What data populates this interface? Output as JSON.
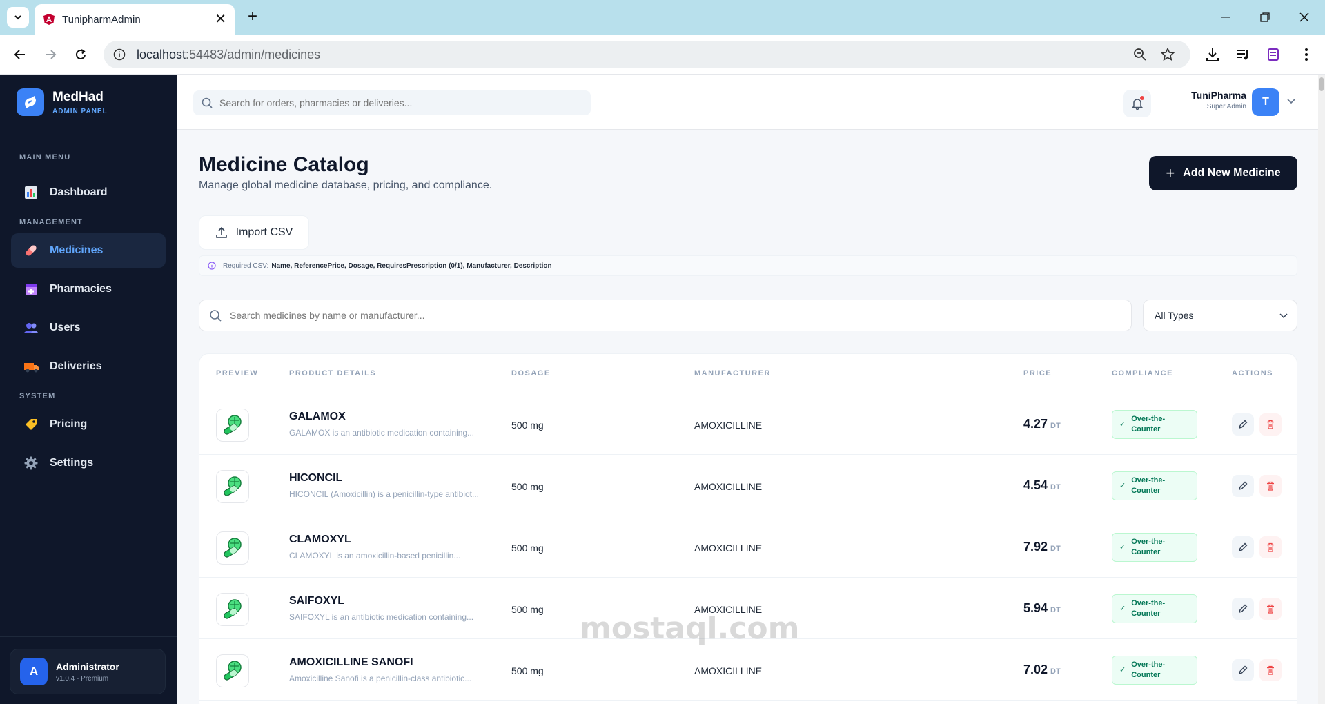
{
  "browser": {
    "tab_title": "TunipharmAdmin",
    "url_host": "localhost",
    "url_rest": ":54483/admin/medicines"
  },
  "brand": {
    "name": "MedHad",
    "subtitle": "ADMIN PANEL"
  },
  "sidebar": {
    "sections": {
      "main": "MAIN MENU",
      "management": "MANAGEMENT",
      "system": "SYSTEM"
    },
    "items": [
      {
        "label": "Dashboard",
        "icon": "chart-icon"
      },
      {
        "label": "Medicines",
        "icon": "pill-icon",
        "active": true
      },
      {
        "label": "Pharmacies",
        "icon": "pharmacy-icon"
      },
      {
        "label": "Users",
        "icon": "users-icon"
      },
      {
        "label": "Deliveries",
        "icon": "truck-icon"
      },
      {
        "label": "Pricing",
        "icon": "tag-icon"
      },
      {
        "label": "Settings",
        "icon": "gear-icon"
      }
    ],
    "user": {
      "initial": "A",
      "name": "Administrator",
      "version": "v1.0.4 - Premium"
    }
  },
  "topbar": {
    "search_placeholder": "Search for orders, pharmacies or deliveries...",
    "user_name": "TuniPharma",
    "user_role": "Super Admin",
    "user_initial": "T"
  },
  "page": {
    "title": "Medicine Catalog",
    "subtitle": "Manage global medicine database, pricing, and compliance.",
    "add_button": "Add New Medicine",
    "import_button": "Import CSV",
    "csv_label": "Required CSV:",
    "csv_fields": "Name, ReferencePrice, Dosage, RequiresPrescription (0/1), Manufacturer, Description",
    "search_placeholder": "Search medicines by name or manufacturer...",
    "type_filter": "All Types"
  },
  "table": {
    "headers": [
      "PREVIEW",
      "PRODUCT DETAILS",
      "DOSAGE",
      "MANUFACTURER",
      "PRICE",
      "COMPLIANCE",
      "ACTIONS"
    ],
    "currency": "DT",
    "rows": [
      {
        "name": "GALAMOX",
        "desc": "GALAMOX is an antibiotic medication containing...",
        "dosage": "500 mg",
        "manufacturer": "AMOXICILLINE",
        "price": "4.27",
        "compliance_1": "Over-the-",
        "compliance_2": "Counter"
      },
      {
        "name": "HICONCIL",
        "desc": "HICONCIL (Amoxicillin) is a penicillin-type antibiot...",
        "dosage": "500 mg",
        "manufacturer": "AMOXICILLINE",
        "price": "4.54",
        "compliance_1": "Over-the-",
        "compliance_2": "Counter"
      },
      {
        "name": "CLAMOXYL",
        "desc": "CLAMOXYL is an amoxicillin-based penicillin...",
        "dosage": "500 mg",
        "manufacturer": "AMOXICILLINE",
        "price": "7.92",
        "compliance_1": "Over-the-",
        "compliance_2": "Counter"
      },
      {
        "name": "SAIFOXYL",
        "desc": "SAIFOXYL is an antibiotic medication containing...",
        "dosage": "500 mg",
        "manufacturer": "AMOXICILLINE",
        "price": "5.94",
        "compliance_1": "Over-the-",
        "compliance_2": "Counter"
      },
      {
        "name": "AMOXICILLINE SANOFI",
        "desc": "Amoxicilline Sanofi is a penicillin-class antibiotic...",
        "dosage": "500 mg",
        "manufacturer": "AMOXICILLINE",
        "price": "7.02",
        "compliance_1": "Over-the-",
        "compliance_2": "Counter"
      }
    ]
  },
  "watermark": "mostaql.com",
  "colors": {
    "sidebar_bg": "#0f172a",
    "accent": "#3b82f6",
    "primary_button": "#0f172a",
    "badge_green": "#047857",
    "delete_red": "#ef4444"
  }
}
